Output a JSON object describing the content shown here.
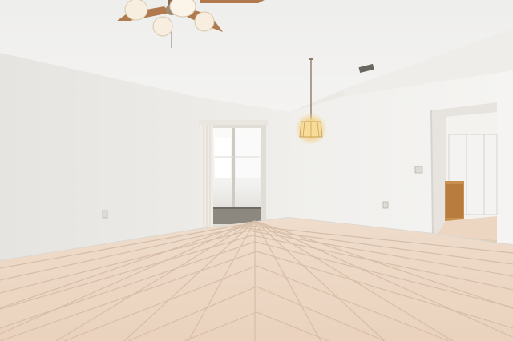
{
  "scene": {
    "description_free": true,
    "palette": {
      "ceiling": "#f1f0ee",
      "wall_left": "#ecebe8",
      "wall_right": "#f2f1ef",
      "tile": "#ecd8c6",
      "grout": "#d8c2ae",
      "fan_blade": "#b07a4e",
      "glass_shade": "#f7eee0",
      "chandelier_glow": "#f4d48a",
      "cabinet": "#c98f4e",
      "door_white": "#f4f3f1"
    },
    "objects": [
      "ceiling-fan",
      "pendant-chandelier",
      "sliding-glass-door",
      "vertical-blinds",
      "doorway-to-kitchen",
      "closet-bifold-doors",
      "wooden-cabinet",
      "electrical-outlets",
      "light-switch",
      "ceiling-vent",
      "tile-floor"
    ]
  }
}
